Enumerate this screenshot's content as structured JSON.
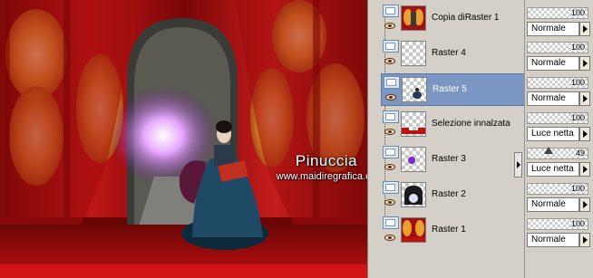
{
  "watermark": {
    "name": "Pinuccia",
    "site": "www.maidiregrafica.eu"
  },
  "layers": [
    {
      "name": "Copia diRaster 1",
      "opacity": "100",
      "blend": "Normale",
      "thumb": "curtains",
      "selected": false
    },
    {
      "name": "Raster 4",
      "opacity": "100",
      "blend": "Normale",
      "thumb": "transparent",
      "selected": false
    },
    {
      "name": "Raster 5",
      "opacity": "100",
      "blend": "Normale",
      "thumb": "figure-small",
      "selected": true
    },
    {
      "name": "Selezione innalzata",
      "opacity": "100",
      "blend": "Luce netta",
      "thumb": "red-strip",
      "selected": false
    },
    {
      "name": "Raster 3",
      "opacity": "49",
      "blend": "Luce netta",
      "thumb": "purple-dot",
      "selected": false
    },
    {
      "name": "Raster 2",
      "opacity": "100",
      "blend": "Normale",
      "thumb": "arch",
      "selected": false
    },
    {
      "name": "Raster 1",
      "opacity": "100",
      "blend": "Normale",
      "thumb": "curtains",
      "selected": false
    }
  ],
  "colors": {
    "selected_row": "#7b96c2",
    "panel_bg": "#d4d0c8",
    "curtain_red": "#b01010",
    "curtain_gold": "#e8a030"
  }
}
